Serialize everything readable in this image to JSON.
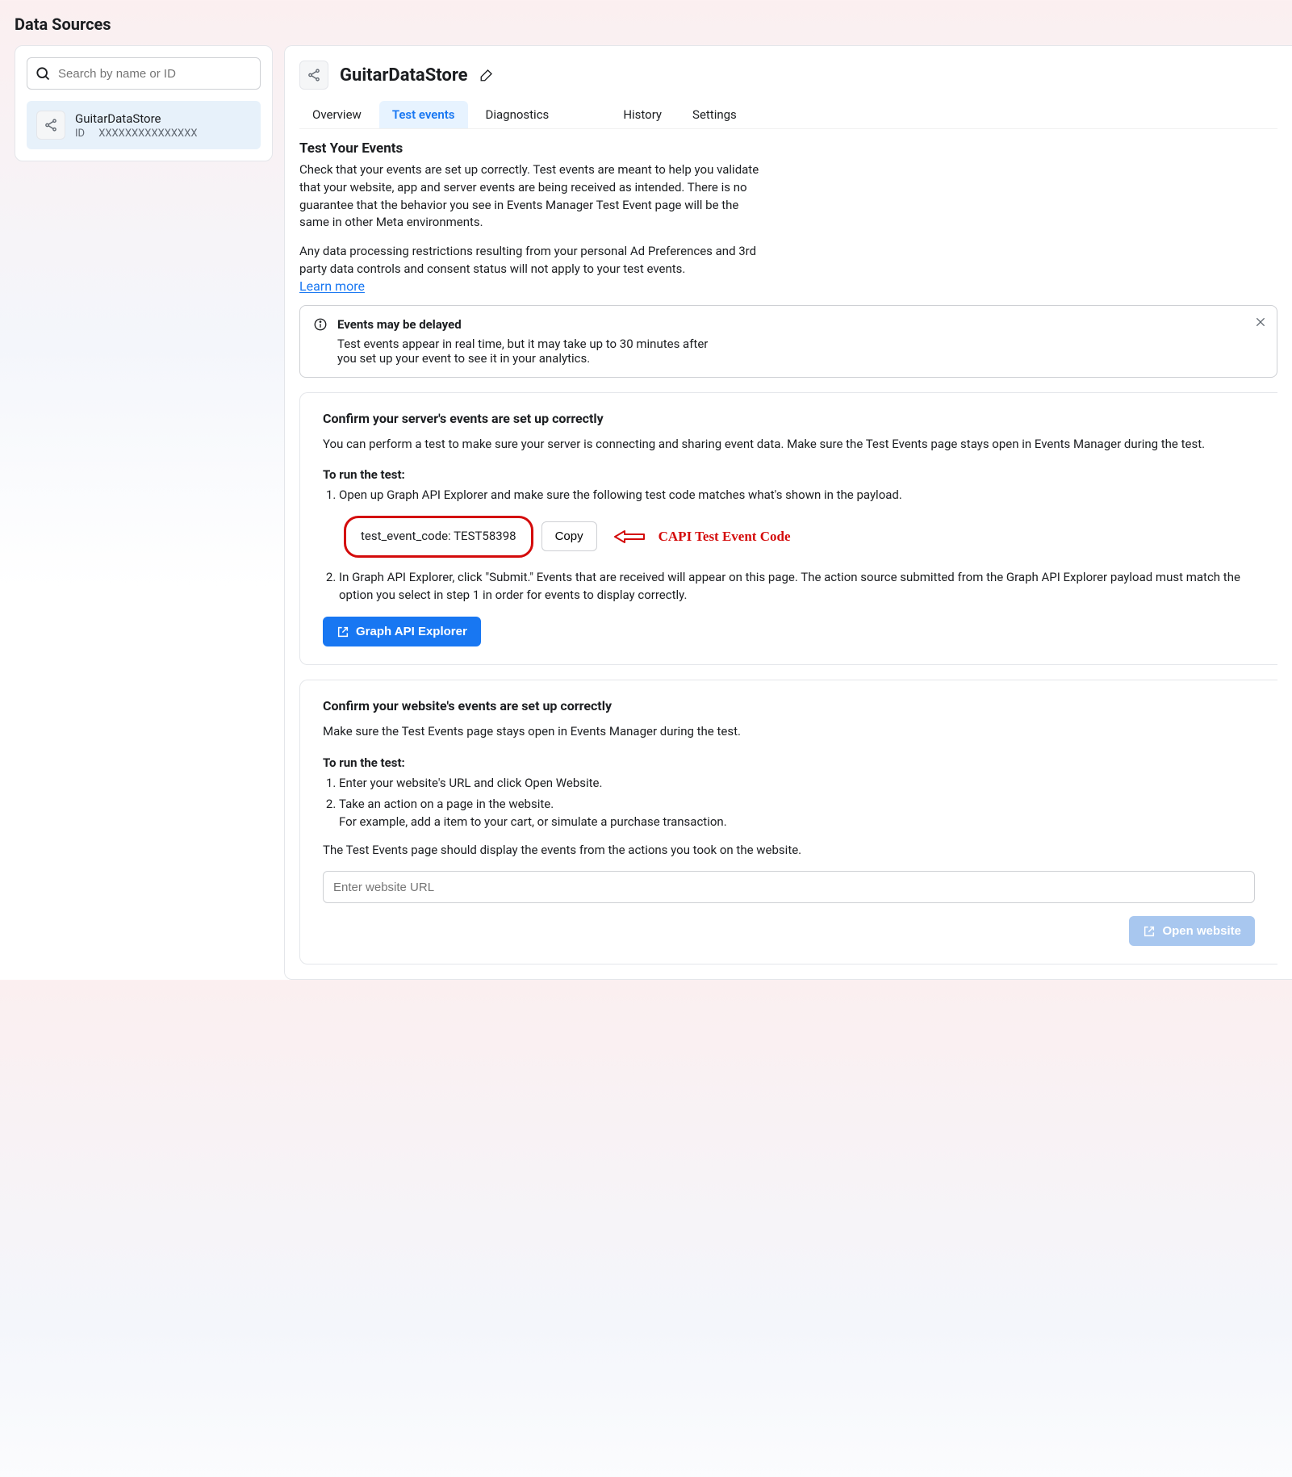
{
  "page": {
    "title": "Data Sources"
  },
  "sidebar": {
    "search_placeholder": "Search by name or ID",
    "items": [
      {
        "name": "GuitarDataStore",
        "id_label": "ID",
        "id_value": "XXXXXXXXXXXXXXX"
      }
    ]
  },
  "header": {
    "title": "GuitarDataStore"
  },
  "tabs": [
    {
      "label": "Overview",
      "active": false
    },
    {
      "label": "Test events",
      "active": true
    },
    {
      "label": "Diagnostics",
      "active": false
    },
    {
      "label": "History",
      "active": false
    },
    {
      "label": "Settings",
      "active": false
    }
  ],
  "intro": {
    "heading": "Test Your Events",
    "para1": "Check that your events are set up correctly. Test events are meant to help you validate that your website, app and server events are being received as intended. There is no guarantee that the behavior you see in Events Manager Test Event page will be the same in other Meta environments.",
    "para2": "Any data processing restrictions resulting from your personal Ad Preferences and 3rd party data controls and consent status will not apply to your test events.",
    "learn_more": "Learn more"
  },
  "notice": {
    "title": "Events may be delayed",
    "message": "Test events appear in real time, but it may take up to 30 minutes after you set up your event to see it in your analytics."
  },
  "server_card": {
    "title": "Confirm your server's events are set up correctly",
    "lead": "You can perform a test to make sure your server is connecting and sharing event data. Make sure the Test Events page stays open in Events Manager during the test.",
    "run_title": "To run the test:",
    "step1": "Open up Graph API Explorer and make sure the following test code matches what's shown in the payload.",
    "code_text": "test_event_code: TEST58398",
    "copy_label": "Copy",
    "annotation": "CAPI Test Event Code",
    "step2": "In Graph API Explorer, click \"Submit.\" Events that are received will appear on this page. The action source submitted from the Graph API Explorer payload must match the option you select in step 1 in order for events to display correctly.",
    "button_label": "Graph API Explorer"
  },
  "website_card": {
    "title": "Confirm your website's events are set up correctly",
    "lead": "Make sure the Test Events page stays open in Events Manager during the test.",
    "run_title": "To run the test:",
    "step1": "Enter your website's URL and click Open Website.",
    "step2a": "Take an action on a page in the website.",
    "step2b": "For example, add a item to your cart, or simulate a purchase transaction.",
    "footer": "The Test Events page should display the events from the actions you took on the website.",
    "url_placeholder": "Enter website URL",
    "open_label": "Open website"
  }
}
